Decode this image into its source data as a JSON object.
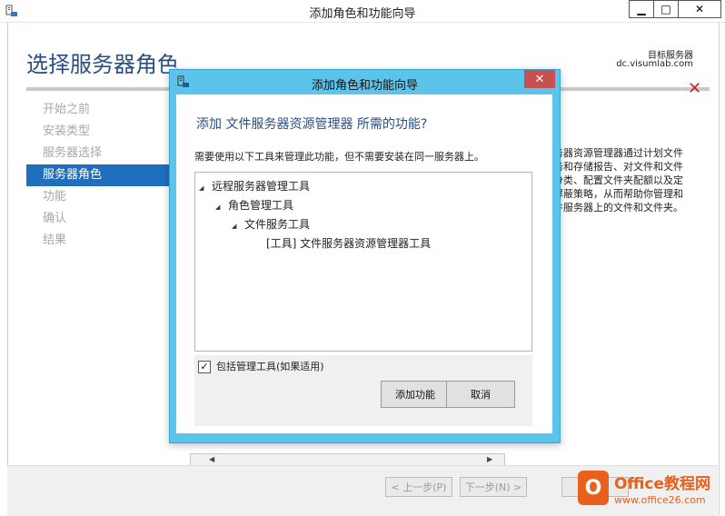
{
  "outer": {
    "title": "添加角色和功能向导",
    "page_title": "选择服务器角色",
    "target_label": "目标服务器",
    "target_value": "dc.visumlab.com",
    "nav": [
      "开始之前",
      "安装类型",
      "服务器选择",
      "服务器角色",
      "功能",
      "确认",
      "结果"
    ],
    "active_nav_index": 3,
    "description_fragment": [
      "务器资源管理器通过计划文件",
      "务和存储报告、对文件和文件",
      "分类、配置文件夹配额以及定",
      "屏蔽策略，从而帮助你管理和",
      "件服务器上的文件和文件夹。"
    ],
    "footer": {
      "prev": "< 上一步(P)",
      "next": "下一步(N) >"
    },
    "controls": {
      "minimize": "▁",
      "maximize": "□",
      "close": "✕"
    },
    "error_icon": "✕"
  },
  "dialog": {
    "title": "添加角色和功能向导",
    "heading": "添加 文件服务器资源管理器 所需的功能?",
    "subtext": "需要使用以下工具来管理此功能，但不需要安装在同一服务器上。",
    "tree": [
      {
        "label": "远程服务器管理工具",
        "level": 0,
        "expanded": true
      },
      {
        "label": "角色管理工具",
        "level": 1,
        "expanded": true
      },
      {
        "label": "文件服务工具",
        "level": 2,
        "expanded": true
      },
      {
        "label": "[工具] 文件服务器资源管理器工具",
        "level": 3,
        "expanded": false
      }
    ],
    "checkbox_label": "包括管理工具(如果适用)",
    "checkbox_checked": true,
    "add_button": "添加功能",
    "cancel_button": "取消",
    "close": "✕"
  },
  "watermark": {
    "logo_letter": "O",
    "line1": "Office教程网",
    "line2": "www.office26.com"
  },
  "colors": {
    "dialog_frame": "#5cc4eb",
    "heading_blue": "#2a4f80",
    "nav_active": "#1f6fbf",
    "close_red": "#c75050",
    "error_red": "#e01c1c",
    "watermark_orange": "#e8601c"
  }
}
